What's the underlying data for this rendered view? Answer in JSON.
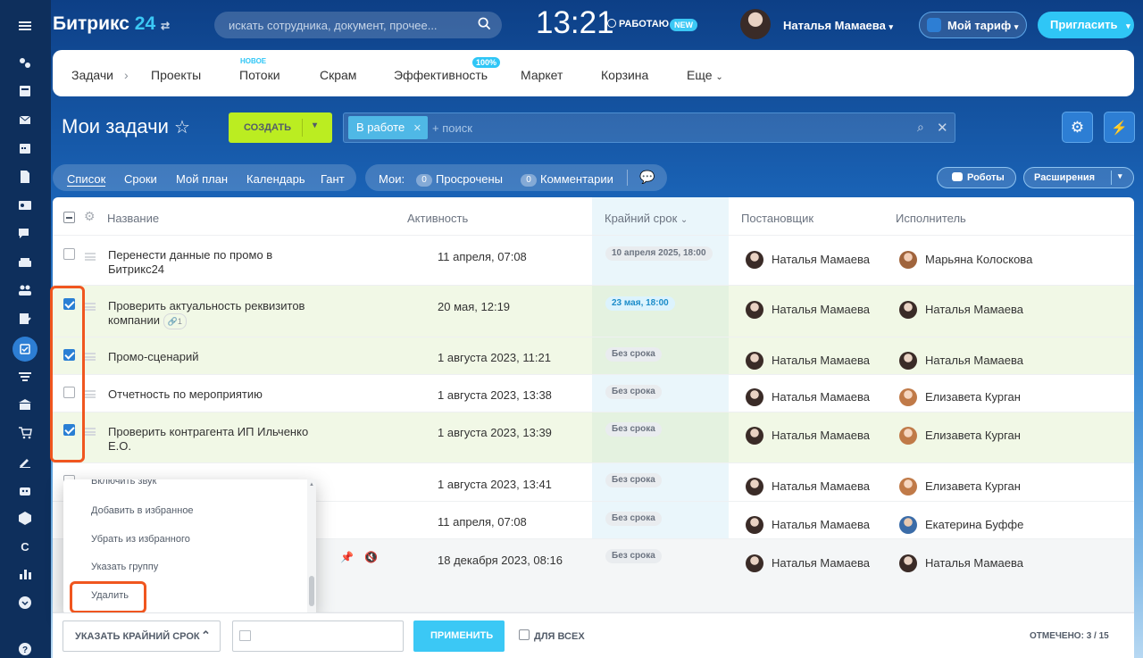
{
  "header": {
    "logo_main": "Битрикс",
    "logo_num": "24",
    "search_placeholder": "искать сотрудника, документ, прочее...",
    "clock": "13:21",
    "work_status": "РАБОТАЮ",
    "new_badge": "NEW",
    "user_name": "Наталья Мамаева",
    "tariff_label": "Мой тариф",
    "invite_label": "Пригласить"
  },
  "topmenu": {
    "items": [
      "Задачи",
      "Проекты",
      "Потоки",
      "Скрам",
      "Эффективность",
      "Маркет",
      "Корзина",
      "Еще"
    ],
    "new_note": "НОВОЕ",
    "eff_badge": "100%"
  },
  "page": {
    "title": "Мои задачи",
    "create_label": "СОЗДАТЬ",
    "filter_chip": "В работе",
    "filter_placeholder": "+ поиск"
  },
  "views": {
    "items": [
      "Список",
      "Сроки",
      "Мой план",
      "Календарь",
      "Гант"
    ],
    "mine_label": "Мои:",
    "overdue_count": "0",
    "overdue_label": "Просрочены",
    "comments_count": "0",
    "comments_label": "Комментарии",
    "robots_label": "Роботы",
    "extensions_label": "Расширения"
  },
  "grid": {
    "headers": {
      "name": "Название",
      "activity": "Активность",
      "deadline": "Крайний срок",
      "creator": "Постановщик",
      "responsible": "Исполнитель"
    },
    "rows": [
      {
        "name": "Перенести данные по промо в Битрикс24",
        "activity": "11 апреля, 07:08",
        "deadline": "10 апреля 2025, 18:00",
        "creator": "Наталья Мамаева",
        "responsible": "Марьяна Колоскова"
      },
      {
        "name": "Проверить актуальность реквизитов компании",
        "attach": "1",
        "activity": "20 мая, 12:19",
        "deadline": "23 мая, 18:00",
        "creator": "Наталья Мамаева",
        "responsible": "Наталья Мамаева"
      },
      {
        "name": "Промо-сценарий",
        "activity": "1 августа 2023, 11:21",
        "deadline": "Без срока",
        "creator": "Наталья Мамаева",
        "responsible": "Наталья Мамаева"
      },
      {
        "name": "Отчетность по мероприятию",
        "activity": "1 августа 2023, 13:38",
        "deadline": "Без срока",
        "creator": "Наталья Мамаева",
        "responsible": "Елизавета Курган"
      },
      {
        "name": "Проверить контрагента ИП Ильченко Е.О.",
        "activity": "1 августа 2023, 13:39",
        "deadline": "Без срока",
        "creator": "Наталья Мамаева",
        "responsible": "Елизавета Курган"
      },
      {
        "name": "",
        "activity": "1 августа 2023, 13:41",
        "deadline": "Без срока",
        "creator": "Наталья Мамаева",
        "responsible": "Елизавета Курган"
      },
      {
        "name": "",
        "activity": "11 апреля, 07:08",
        "deadline": "Без срока",
        "creator": "Наталья Мамаева",
        "responsible": "Екатерина Буффе"
      },
      {
        "name": "",
        "activity": "18 декабря 2023, 08:16",
        "deadline": "Без срока",
        "creator": "Наталья Мамаева",
        "responsible": "Наталья Мамаева"
      }
    ]
  },
  "popup": {
    "items": [
      "Включить звук",
      "Добавить в избранное",
      "Убрать из избранного",
      "Указать группу",
      "Удалить"
    ]
  },
  "bottom": {
    "action_label": "УКАЗАТЬ КРАЙНИЙ СРОК",
    "apply_label": "ПРИМЕНИТЬ",
    "for_all_label": "ДЛЯ ВСЕХ",
    "selected_label": "ОТМЕЧЕНО: 3 / 15"
  },
  "colors": {
    "accent": "#2fc6f6",
    "create": "#bbed21",
    "highlight": "#f0561f",
    "selected_row": "#f1f8e6"
  }
}
